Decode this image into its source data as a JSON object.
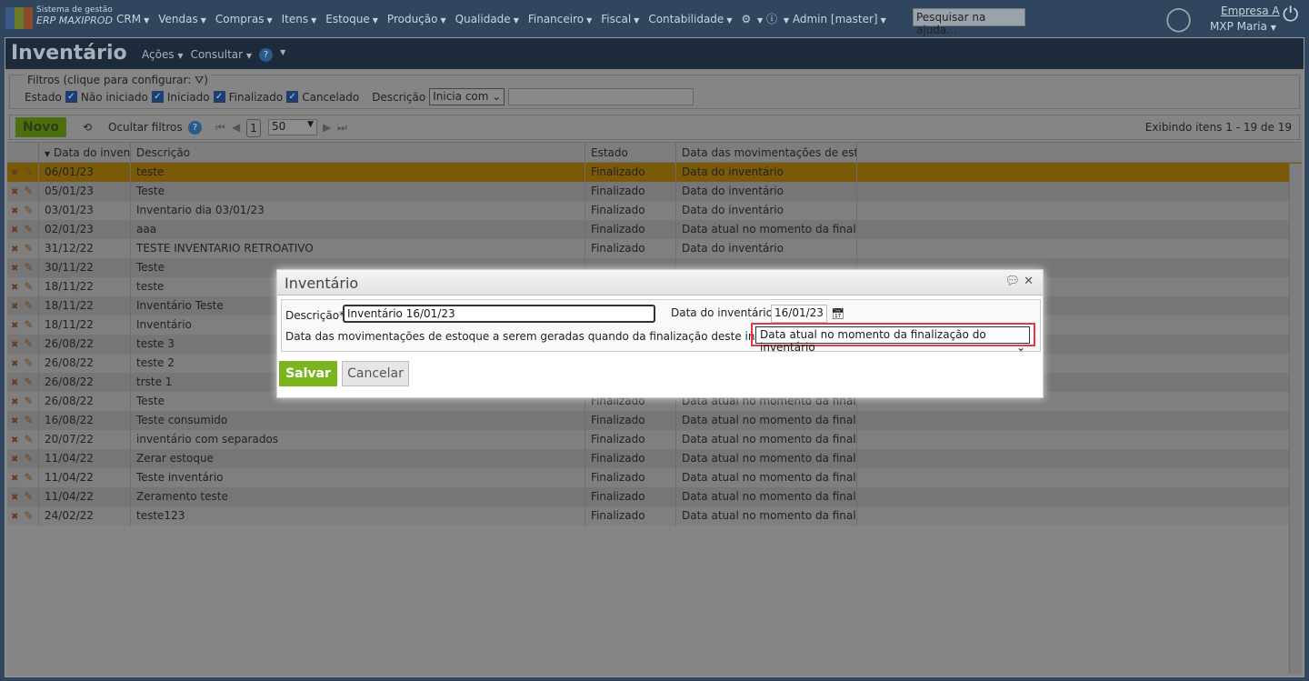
{
  "topbar": {
    "brand_line1": "Sistema de gestão",
    "brand_line2": "ERP MAXIPROD",
    "menu": [
      "CRM",
      "Vendas",
      "Compras",
      "Itens",
      "Estoque",
      "Produção",
      "Qualidade",
      "Financeiro",
      "Fiscal",
      "Contabilidade"
    ],
    "admin": "Admin [master]",
    "search_placeholder": "Pesquisar na ajuda...",
    "company": "Empresa A",
    "user": "MXP Maria"
  },
  "page": {
    "title": "Inventário",
    "menu": [
      "Ações",
      "Consultar"
    ]
  },
  "filters": {
    "legend": "Filtros (clique para configurar:",
    "estado_label": "Estado",
    "checks": [
      "Não iniciado",
      "Iniciado",
      "Finalizado",
      "Cancelado"
    ],
    "descricao_label": "Descrição",
    "match_mode": "Inicia com",
    "descricao_value": ""
  },
  "toolbar": {
    "new": "Novo",
    "hide_filters": "Ocultar filtros",
    "page": "1",
    "per_page": "50",
    "showing": "Exibindo itens 1 - 19 de 19"
  },
  "grid": {
    "headers": [
      "Data do invent",
      "Descrição",
      "Estado",
      "Data das movimentações de estoqu"
    ],
    "rows": [
      [
        "06/01/23",
        "teste",
        "Finalizado",
        "Data do inventário"
      ],
      [
        "05/01/23",
        "Teste",
        "Finalizado",
        "Data do inventário"
      ],
      [
        "03/01/23",
        "Inventario dia 03/01/23",
        "Finalizado",
        "Data do inventário"
      ],
      [
        "02/01/23",
        "aaa",
        "Finalizado",
        "Data atual no momento da finali..."
      ],
      [
        "31/12/22",
        "TESTE INVENTARIO RETROATIVO",
        "Finalizado",
        "Data do inventário"
      ],
      [
        "30/11/22",
        "Teste",
        "",
        ""
      ],
      [
        "18/11/22",
        "teste",
        "",
        ""
      ],
      [
        "18/11/22",
        "Inventário Teste",
        "",
        ""
      ],
      [
        "18/11/22",
        "Inventário",
        "",
        ""
      ],
      [
        "26/08/22",
        "teste 3",
        "",
        ""
      ],
      [
        "26/08/22",
        "teste 2",
        "",
        ""
      ],
      [
        "26/08/22",
        "trste 1",
        "",
        ""
      ],
      [
        "26/08/22",
        "Teste",
        "Finalizado",
        "Data atual no momento da finali..."
      ],
      [
        "16/08/22",
        "Teste consumido",
        "Finalizado",
        "Data atual no momento da finali..."
      ],
      [
        "20/07/22",
        "inventário com separados",
        "Finalizado",
        "Data atual no momento da finali..."
      ],
      [
        "11/04/22",
        "Zerar estoque",
        "Finalizado",
        "Data atual no momento da finali..."
      ],
      [
        "11/04/22",
        "Teste inventário",
        "Finalizado",
        "Data atual no momento da finali..."
      ],
      [
        "11/04/22",
        "Zeramento teste",
        "Finalizado",
        "Data atual no momento da finali..."
      ],
      [
        "24/02/22",
        "teste123",
        "Finalizado",
        "Data atual no momento da finali..."
      ]
    ]
  },
  "dialog": {
    "title": "Inventário",
    "descricao_label": "Descrição*",
    "descricao_value": "Inventário 16/01/23",
    "data_label": "Data do inventário*",
    "data_value": "16/01/23",
    "mov_label": "Data das movimentações de estoque a serem geradas quando da finalização deste inventário*",
    "mov_value": "Data atual no momento da finalização do inventário",
    "save": "Salvar",
    "cancel": "Cancelar"
  },
  "colors": {
    "save": "#7ab51d",
    "highlight_box": "#e23c3c",
    "selected_row": "#7a5a08"
  }
}
